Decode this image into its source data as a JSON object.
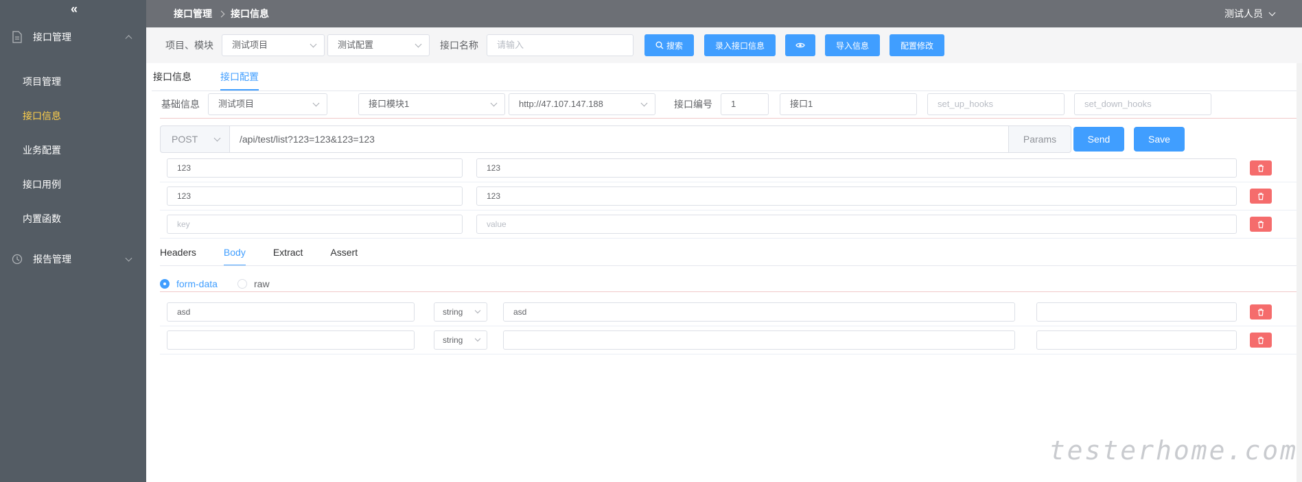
{
  "sidebar": {
    "collapse_icon": "«",
    "groups": [
      {
        "label": "接口管理",
        "icon": "document-icon"
      },
      {
        "label": "报告管理",
        "icon": "clock-icon"
      }
    ],
    "items": [
      {
        "label": "项目管理"
      },
      {
        "label": "接口信息"
      },
      {
        "label": "业务配置"
      },
      {
        "label": "接口用例"
      },
      {
        "label": "内置函数"
      }
    ]
  },
  "header": {
    "breadcrumb": [
      "接口管理",
      "接口信息"
    ],
    "user": "测试人员"
  },
  "filter": {
    "label_project": "项目、模块",
    "project_value": "测试项目",
    "config_value": "测试配置",
    "label_name": "接口名称",
    "name_placeholder": "请输入",
    "btn_search": "搜索",
    "btn_add": "录入接口信息",
    "btn_import": "导入信息",
    "btn_config": "配置修改"
  },
  "tabs": [
    "接口信息",
    "接口配置"
  ],
  "base": {
    "label": "基础信息",
    "project": "测试项目",
    "module": "接口模块1",
    "host": "http://47.107.147.188",
    "label_no": "接口编号",
    "no": "1",
    "name": "接口1",
    "setup_placeholder": "set_up_hooks",
    "teardown_placeholder": "set_down_hooks"
  },
  "request": {
    "method": "POST",
    "url": "/api/test/list?123=123&123=123",
    "params_label": "Params",
    "send_label": "Send",
    "save_label": "Save"
  },
  "params": [
    {
      "key": "123",
      "value": "123"
    },
    {
      "key": "123",
      "value": "123"
    },
    {
      "key_placeholder": "key",
      "value_placeholder": "value"
    }
  ],
  "body_tabs": [
    "Headers",
    "Body",
    "Extract",
    "Assert"
  ],
  "body_type": [
    "form-data",
    "raw"
  ],
  "form_rows": [
    {
      "key": "asd",
      "type": "string",
      "value": "asd",
      "desc": ""
    },
    {
      "key": "",
      "type": "string",
      "value": "",
      "desc": ""
    }
  ],
  "watermark": "testerhome.com",
  "colors": {
    "primary": "#409eff",
    "danger": "#f56c6c",
    "sidebar": "#545c64",
    "active": "#ffd04b"
  }
}
